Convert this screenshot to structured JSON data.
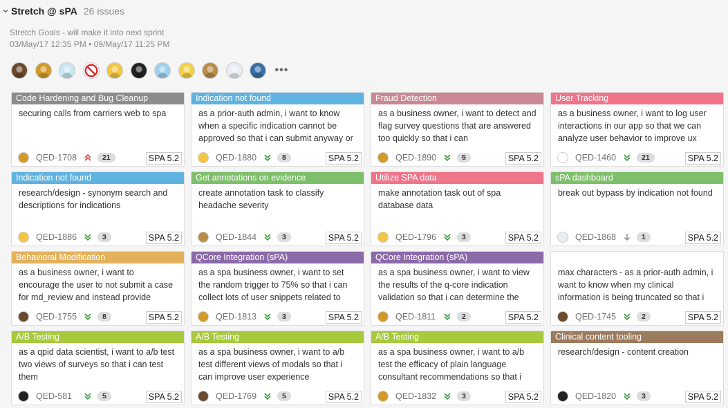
{
  "header": {
    "title": "Stretch @ sPA",
    "issue_count": "26 issues",
    "description": "Stretch Goals - will make it into next sprint",
    "date_range": "03/May/17 12:35 PM  •  09/May/17 11:25 PM"
  },
  "avatars": [
    {
      "name": "avatar-photo-brown",
      "color": "#6b4a2e"
    },
    {
      "name": "avatar-monkey",
      "color": "#d39a2a"
    },
    {
      "name": "avatar-man-face",
      "color": "#c8e6f0"
    },
    {
      "name": "avatar-no-sign",
      "color": "#ffffff"
    },
    {
      "name": "avatar-yellow-face",
      "color": "#f4c542"
    },
    {
      "name": "avatar-piano",
      "color": "#222222"
    },
    {
      "name": "avatar-boy-face",
      "color": "#9fd1ec"
    },
    {
      "name": "avatar-dog",
      "color": "#f2d04a"
    },
    {
      "name": "avatar-cheetah",
      "color": "#b88d4a"
    },
    {
      "name": "avatar-ghost",
      "color": "#e8eef3"
    },
    {
      "name": "avatar-man-tie",
      "color": "#3a6ea5"
    }
  ],
  "more_label": "•••",
  "cards": [
    {
      "epic": "Code Hardening and Bug Cleanup",
      "epic_color": "#8c8c8c",
      "summary": "securing calls from carriers web to spa",
      "avatar_color": "#d39a2a",
      "key": "QED-1708",
      "priority": "highest",
      "points": "21",
      "version": "SPA 5.2"
    },
    {
      "epic": "Indication not found",
      "epic_color": "#5fb3e0",
      "summary": "as a prior-auth admin, i want to know when a specific indication cannot be approved so that i can submit anyway or",
      "avatar_color": "#f4c542",
      "key": "QED-1880",
      "priority": "lowest",
      "points": "8",
      "version": "SPA 5.2"
    },
    {
      "epic": "Fraud Detection",
      "epic_color": "#c98893",
      "summary": "as a business owner, i want to detect and flag survey questions that are answered too quickly so that i can",
      "avatar_color": "#d39a2a",
      "key": "QED-1890",
      "priority": "lowest",
      "points": "5",
      "version": "SPA 5.2"
    },
    {
      "epic": "User Tracking",
      "epic_color": "#f0748a",
      "summary": "as a business owner, i want to log user interactions in our app so that we can analyze user behavior to improve ux",
      "avatar_color": "#ffffff",
      "key": "QED-1460",
      "priority": "lowest",
      "points": "21",
      "version": "SPA 5.2"
    },
    {
      "epic": "Indication not found",
      "epic_color": "#5fb3e0",
      "summary": "research/design - synonym search and descriptions for indications",
      "avatar_color": "#f4c542",
      "key": "QED-1886",
      "priority": "lowest",
      "points": "3",
      "version": "SPA 5.2"
    },
    {
      "epic": "Get annotations on evidence",
      "epic_color": "#7dbf6a",
      "summary": "create annotation task to classify headache severity",
      "avatar_color": "#b88d4a",
      "key": "QED-1844",
      "priority": "lowest",
      "points": "3",
      "version": "SPA 5.2"
    },
    {
      "epic": "Utilize SPA data",
      "epic_color": "#f0748a",
      "summary": "make annotation task out of spa database data",
      "avatar_color": "#f4c542",
      "key": "QED-1796",
      "priority": "lowest",
      "points": "3",
      "version": "SPA 5.2"
    },
    {
      "epic": "sPA dashboard",
      "epic_color": "#7dbf6a",
      "summary": "break out bypass by indication not found",
      "avatar_color": "#e8eef3",
      "key": "QED-1868",
      "priority": "low",
      "points": "1",
      "version": "SPA 5.2"
    },
    {
      "epic": "Behavioral Modification",
      "epic_color": "#e3b15a",
      "summary": "as a business owner, i want to encourage the user to not submit a case for md_review and instead provide",
      "avatar_color": "#6b4a2e",
      "key": "QED-1755",
      "priority": "lowest",
      "points": "8",
      "version": "SPA 5.2"
    },
    {
      "epic": "QCore Integration (sPA)",
      "epic_color": "#8b6aa8",
      "summary": "as a spa business owner, i want to set the random trigger to 75% so that i can collect lots of user snippets related to",
      "avatar_color": "#d39a2a",
      "key": "QED-1813",
      "priority": "lowest",
      "points": "3",
      "version": "SPA 5.2"
    },
    {
      "epic": "QCore Integration (sPA)",
      "epic_color": "#8b6aa8",
      "summary": "as a spa business owner, i want to view the results of the q-core indication validation so that i can determine the",
      "avatar_color": "#d39a2a",
      "key": "QED-1811",
      "priority": "lowest",
      "points": "2",
      "version": "SPA 5.2"
    },
    {
      "epic": "",
      "epic_color": "#ffffff",
      "summary": "max characters - as a prior-auth admin, i want to know when my clinical information is being truncated so that i",
      "avatar_color": "#6b4a2e",
      "key": "QED-1745",
      "priority": "lowest",
      "points": "2",
      "version": "SPA 5.2"
    },
    {
      "epic": "A/B Testing",
      "epic_color": "#a7c93b",
      "summary": "as a qpid data scientist, i want to a/b test two views of surveys so that i can test them",
      "avatar_color": "#222222",
      "key": "QED-581",
      "priority": "lowest",
      "points": "5",
      "version": "SPA 5.2"
    },
    {
      "epic": "A/B Testing",
      "epic_color": "#a7c93b",
      "summary": "as a spa business owner, i want to a/b test different views of modals so that i can improve user experience",
      "avatar_color": "#6b4a2e",
      "key": "QED-1769",
      "priority": "lowest",
      "points": "5",
      "version": "SPA 5.2"
    },
    {
      "epic": "A/B Testing",
      "epic_color": "#a7c93b",
      "summary": "as a spa business owner, i want to a/b test the efficacy of plain language consultant recommendations so that i",
      "avatar_color": "#d39a2a",
      "key": "QED-1832",
      "priority": "lowest",
      "points": "3",
      "version": "SPA 5.2"
    },
    {
      "epic": "Clinical content tooling",
      "epic_color": "#9c7a5c",
      "summary": "research/design - content creation",
      "avatar_color": "#222222",
      "key": "QED-1820",
      "priority": "lowest",
      "points": "3",
      "version": "SPA 5.2"
    }
  ]
}
